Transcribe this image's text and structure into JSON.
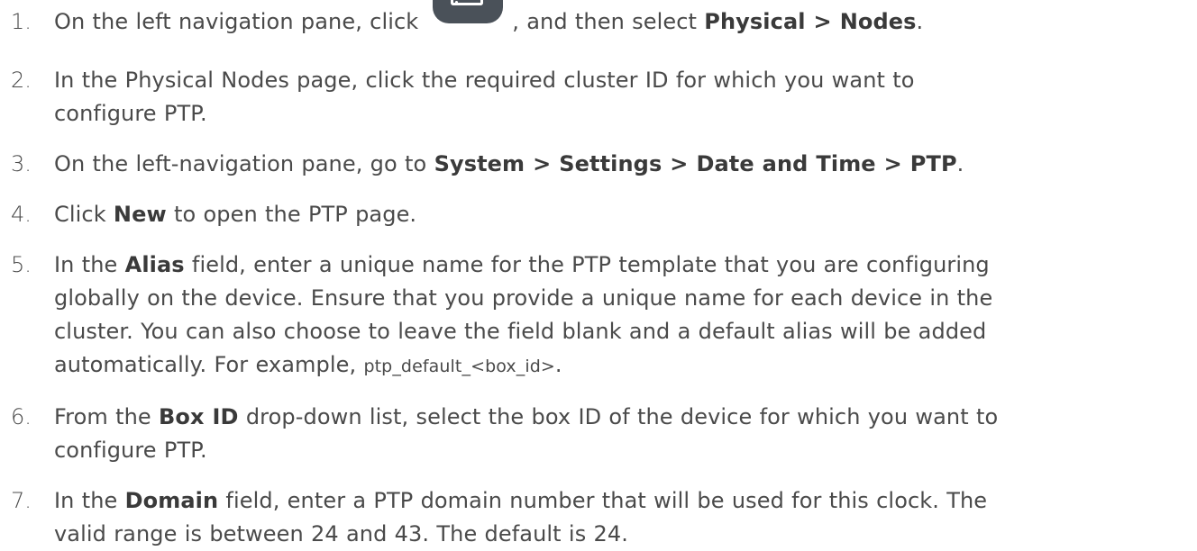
{
  "steps": [
    {
      "num": "1.",
      "t1": "On the left navigation pane, click",
      "icon": "server-nav-icon",
      "t2": ", and then select",
      "b1": "Physical > Nodes",
      "t3": "."
    },
    {
      "num": "2.",
      "line1": "In the Physical Nodes page, click the required cluster ID for which you want to",
      "line2": "configure PTP."
    },
    {
      "num": "3.",
      "t1": "On the left-navigation pane, go to",
      "b1": "System > Settings > Date and Time > PTP",
      "t2": "."
    },
    {
      "num": "4.",
      "t1": "Click",
      "b1": "New",
      "t2": "to open the PTP page."
    },
    {
      "num": "5.",
      "t1": "In the",
      "b1": "Alias",
      "t2": "field, enter a unique name for the PTP template that you are configuring",
      "line2": "globally on the device. Ensure that you provide a unique name for each device in the",
      "line3": "cluster. You can also choose to leave the field blank and a default alias will be added",
      "line4a": "automatically. For example,",
      "code": "ptp_default_<box_id>",
      "line4b": "."
    },
    {
      "num": "6.",
      "t1": "From the",
      "b1": "Box ID",
      "t2": "drop-down list, select the box ID of the device for which you want to",
      "line2": "configure PTP."
    },
    {
      "num": "7.",
      "t1": "In the",
      "b1": "Domain",
      "t2": "field, enter a PTP domain number that will be used for this clock. The",
      "line2": "valid range is between 24 and 43. The default is 24."
    }
  ],
  "colors": {
    "text": "#4a4a4a",
    "bold": "#3a3a3a",
    "icon_bg": "#4a5159",
    "background": "#ffffff"
  }
}
